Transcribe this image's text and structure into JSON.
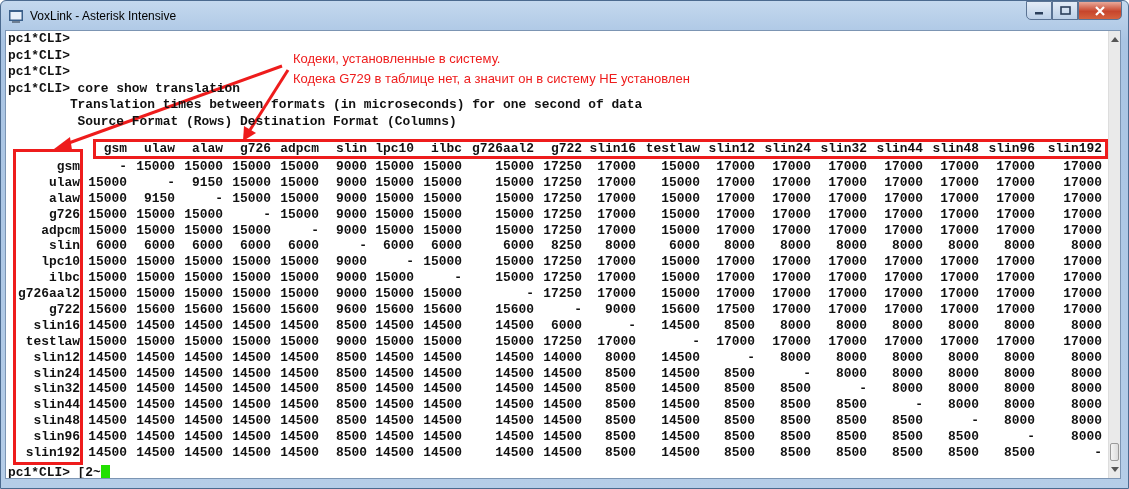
{
  "window": {
    "title": "VoxLink - Asterisk Intensive"
  },
  "console_lines": [
    "pc1*CLI>",
    "pc1*CLI>",
    "pc1*CLI>",
    "pc1*CLI> core show translation",
    "        Translation times between formats (in microseconds) for one second of data",
    "         Source Format (Rows) Destination Format (Columns)"
  ],
  "annotation": {
    "lines": [
      "Кодеки, установленные в систему.",
      "Кодека G729 в таблице нет, а значит он в систему НЕ установлен"
    ]
  },
  "table": {
    "columns": [
      "gsm",
      "ulaw",
      "alaw",
      "g726",
      "adpcm",
      "slin",
      "lpc10",
      "ilbc",
      "g726aal2",
      "g722",
      "slin16",
      "testlaw",
      "slin12",
      "slin24",
      "slin32",
      "slin44",
      "slin48",
      "slin96",
      "slin192"
    ],
    "rows": [
      {
        "label": "gsm",
        "cells": [
          "-",
          "15000",
          "15000",
          "15000",
          "15000",
          "9000",
          "15000",
          "15000",
          "15000",
          "17250",
          "17000",
          "15000",
          "17000",
          "17000",
          "17000",
          "17000",
          "17000",
          "17000",
          "17000"
        ]
      },
      {
        "label": "ulaw",
        "cells": [
          "15000",
          "-",
          "9150",
          "15000",
          "15000",
          "9000",
          "15000",
          "15000",
          "15000",
          "17250",
          "17000",
          "15000",
          "17000",
          "17000",
          "17000",
          "17000",
          "17000",
          "17000",
          "17000"
        ]
      },
      {
        "label": "alaw",
        "cells": [
          "15000",
          "9150",
          "-",
          "15000",
          "15000",
          "9000",
          "15000",
          "15000",
          "15000",
          "17250",
          "17000",
          "15000",
          "17000",
          "17000",
          "17000",
          "17000",
          "17000",
          "17000",
          "17000"
        ]
      },
      {
        "label": "g726",
        "cells": [
          "15000",
          "15000",
          "15000",
          "-",
          "15000",
          "9000",
          "15000",
          "15000",
          "15000",
          "17250",
          "17000",
          "15000",
          "17000",
          "17000",
          "17000",
          "17000",
          "17000",
          "17000",
          "17000"
        ]
      },
      {
        "label": "adpcm",
        "cells": [
          "15000",
          "15000",
          "15000",
          "15000",
          "-",
          "9000",
          "15000",
          "15000",
          "15000",
          "17250",
          "17000",
          "15000",
          "17000",
          "17000",
          "17000",
          "17000",
          "17000",
          "17000",
          "17000"
        ]
      },
      {
        "label": "slin",
        "cells": [
          "6000",
          "6000",
          "6000",
          "6000",
          "6000",
          "-",
          "6000",
          "6000",
          "6000",
          "8250",
          "8000",
          "6000",
          "8000",
          "8000",
          "8000",
          "8000",
          "8000",
          "8000",
          "8000"
        ]
      },
      {
        "label": "lpc10",
        "cells": [
          "15000",
          "15000",
          "15000",
          "15000",
          "15000",
          "9000",
          "-",
          "15000",
          "15000",
          "17250",
          "17000",
          "15000",
          "17000",
          "17000",
          "17000",
          "17000",
          "17000",
          "17000",
          "17000"
        ]
      },
      {
        "label": "ilbc",
        "cells": [
          "15000",
          "15000",
          "15000",
          "15000",
          "15000",
          "9000",
          "15000",
          "-",
          "15000",
          "17250",
          "17000",
          "15000",
          "17000",
          "17000",
          "17000",
          "17000",
          "17000",
          "17000",
          "17000"
        ]
      },
      {
        "label": "g726aal2",
        "cells": [
          "15000",
          "15000",
          "15000",
          "15000",
          "15000",
          "9000",
          "15000",
          "15000",
          "-",
          "17250",
          "17000",
          "15000",
          "17000",
          "17000",
          "17000",
          "17000",
          "17000",
          "17000",
          "17000"
        ]
      },
      {
        "label": "g722",
        "cells": [
          "15600",
          "15600",
          "15600",
          "15600",
          "15600",
          "9600",
          "15600",
          "15600",
          "15600",
          "-",
          "9000",
          "15600",
          "17500",
          "17000",
          "17000",
          "17000",
          "17000",
          "17000",
          "17000"
        ]
      },
      {
        "label": "slin16",
        "cells": [
          "14500",
          "14500",
          "14500",
          "14500",
          "14500",
          "8500",
          "14500",
          "14500",
          "14500",
          "6000",
          "-",
          "14500",
          "8500",
          "8000",
          "8000",
          "8000",
          "8000",
          "8000",
          "8000"
        ]
      },
      {
        "label": "testlaw",
        "cells": [
          "15000",
          "15000",
          "15000",
          "15000",
          "15000",
          "9000",
          "15000",
          "15000",
          "15000",
          "17250",
          "17000",
          "-",
          "17000",
          "17000",
          "17000",
          "17000",
          "17000",
          "17000",
          "17000"
        ]
      },
      {
        "label": "slin12",
        "cells": [
          "14500",
          "14500",
          "14500",
          "14500",
          "14500",
          "8500",
          "14500",
          "14500",
          "14500",
          "14000",
          "8000",
          "14500",
          "-",
          "8000",
          "8000",
          "8000",
          "8000",
          "8000",
          "8000"
        ]
      },
      {
        "label": "slin24",
        "cells": [
          "14500",
          "14500",
          "14500",
          "14500",
          "14500",
          "8500",
          "14500",
          "14500",
          "14500",
          "14500",
          "8500",
          "14500",
          "8500",
          "-",
          "8000",
          "8000",
          "8000",
          "8000",
          "8000"
        ]
      },
      {
        "label": "slin32",
        "cells": [
          "14500",
          "14500",
          "14500",
          "14500",
          "14500",
          "8500",
          "14500",
          "14500",
          "14500",
          "14500",
          "8500",
          "14500",
          "8500",
          "8500",
          "-",
          "8000",
          "8000",
          "8000",
          "8000"
        ]
      },
      {
        "label": "slin44",
        "cells": [
          "14500",
          "14500",
          "14500",
          "14500",
          "14500",
          "8500",
          "14500",
          "14500",
          "14500",
          "14500",
          "8500",
          "14500",
          "8500",
          "8500",
          "8500",
          "-",
          "8000",
          "8000",
          "8000"
        ]
      },
      {
        "label": "slin48",
        "cells": [
          "14500",
          "14500",
          "14500",
          "14500",
          "14500",
          "8500",
          "14500",
          "14500",
          "14500",
          "14500",
          "8500",
          "14500",
          "8500",
          "8500",
          "8500",
          "8500",
          "-",
          "8000",
          "8000"
        ]
      },
      {
        "label": "slin96",
        "cells": [
          "14500",
          "14500",
          "14500",
          "14500",
          "14500",
          "8500",
          "14500",
          "14500",
          "14500",
          "14500",
          "8500",
          "14500",
          "8500",
          "8500",
          "8500",
          "8500",
          "8500",
          "-",
          "8000"
        ]
      },
      {
        "label": "slin192",
        "cells": [
          "14500",
          "14500",
          "14500",
          "14500",
          "14500",
          "8500",
          "14500",
          "14500",
          "14500",
          "14500",
          "8500",
          "14500",
          "8500",
          "8500",
          "8500",
          "8500",
          "8500",
          "8500",
          "-"
        ]
      }
    ]
  },
  "prompt": "pc1*CLI> [2~"
}
